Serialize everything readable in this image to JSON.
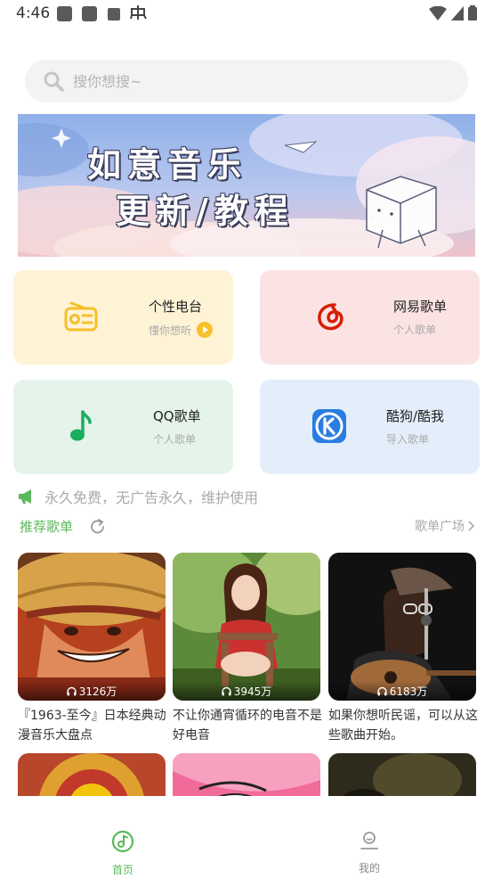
{
  "status_bar": {
    "time": "4:46"
  },
  "search": {
    "placeholder": "搜你想搜~"
  },
  "banner": {
    "line1": "如意音乐",
    "line2": "更新/教程"
  },
  "cards": [
    {
      "title": "个性电台",
      "subtitle": "懂你想听",
      "color": "#fff3d6",
      "accent": "#f5c02a"
    },
    {
      "title": "网易歌单",
      "subtitle": "个人歌单",
      "color": "#fbe3e3",
      "accent": "#d81e06"
    },
    {
      "title": "QQ歌单",
      "subtitle": "个人歌单",
      "color": "#e5f4ea",
      "accent": "#1aad5e"
    },
    {
      "title": "酷狗/酷我",
      "subtitle": "导入歌单",
      "color": "#e4eefb",
      "accent": "#2a7de1"
    }
  ],
  "notice": {
    "text": "永久免费，无广告永久，维护使用"
  },
  "recommend": {
    "title": "推荐歌单",
    "more": "歌单广场"
  },
  "playlists": [
    {
      "plays": "3126万",
      "title": "『1963-至今』日本经典动漫音乐大盘点"
    },
    {
      "plays": "3945万",
      "title": "不让你通宵循环的电音不是好电音"
    },
    {
      "plays": "6183万",
      "title": "如果你想听民谣，可以从这些歌曲开始。"
    }
  ],
  "nav": {
    "home": "首页",
    "mine": "我的",
    "active_color": "#5cb85c",
    "inactive_color": "#888888"
  }
}
